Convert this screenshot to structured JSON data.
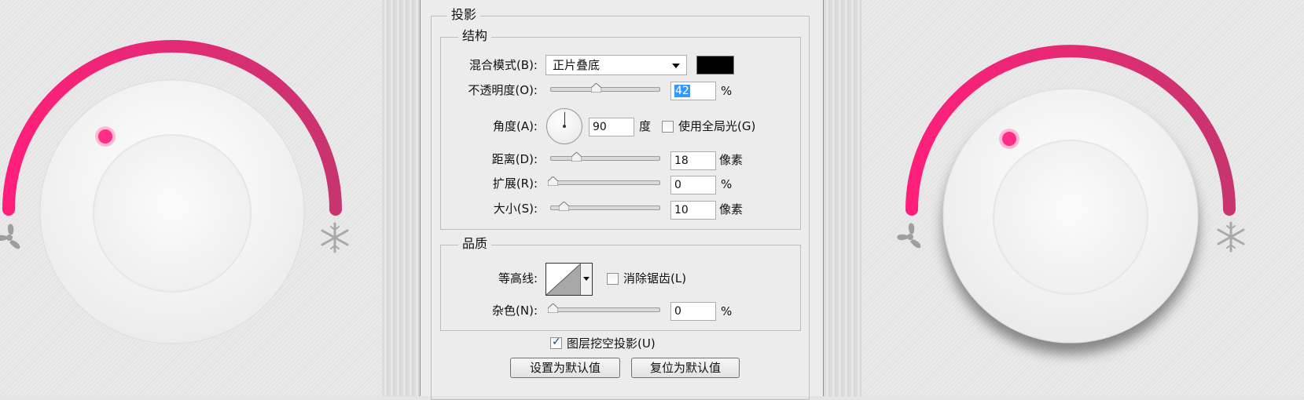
{
  "colors": {
    "accent": "#ff1f7a",
    "accent_dark": "#c42f6e",
    "icon_gray": "#9e9e9e"
  },
  "dialog": {
    "section_title": "投影",
    "structure": {
      "legend": "结构",
      "blend_mode_label": "混合模式(B):",
      "blend_mode_value": "正片叠底",
      "blend_color": "#000000",
      "opacity_label": "不透明度(O):",
      "opacity_value": "42",
      "opacity_unit": "%",
      "opacity_fraction": 0.42,
      "angle_label": "角度(A):",
      "angle_value": "90",
      "angle_unit": "度",
      "global_light_label": "使用全局光(G)",
      "global_light_checked": false,
      "distance_label": "距离(D):",
      "distance_value": "18",
      "distance_unit": "像素",
      "spread_label": "扩展(R):",
      "spread_value": "0",
      "spread_unit": "%",
      "size_label": "大小(S):",
      "size_value": "10",
      "size_unit": "像素"
    },
    "quality": {
      "legend": "品质",
      "contour_label": "等高线:",
      "anti_alias_label": "消除锯齿(L)",
      "anti_alias_checked": false,
      "noise_label": "杂色(N):",
      "noise_value": "0",
      "noise_unit": "%"
    },
    "knockout_label": "图层挖空投影(U)",
    "knockout_checked": true,
    "make_default_label": "设置为默认值",
    "reset_default_label": "复位为默认值"
  },
  "knobs": [
    {
      "icon_left": "fan-icon",
      "icon_right": "snowflake-icon"
    },
    {
      "icon_left": "fan-icon",
      "icon_right": "snowflake-icon"
    }
  ]
}
